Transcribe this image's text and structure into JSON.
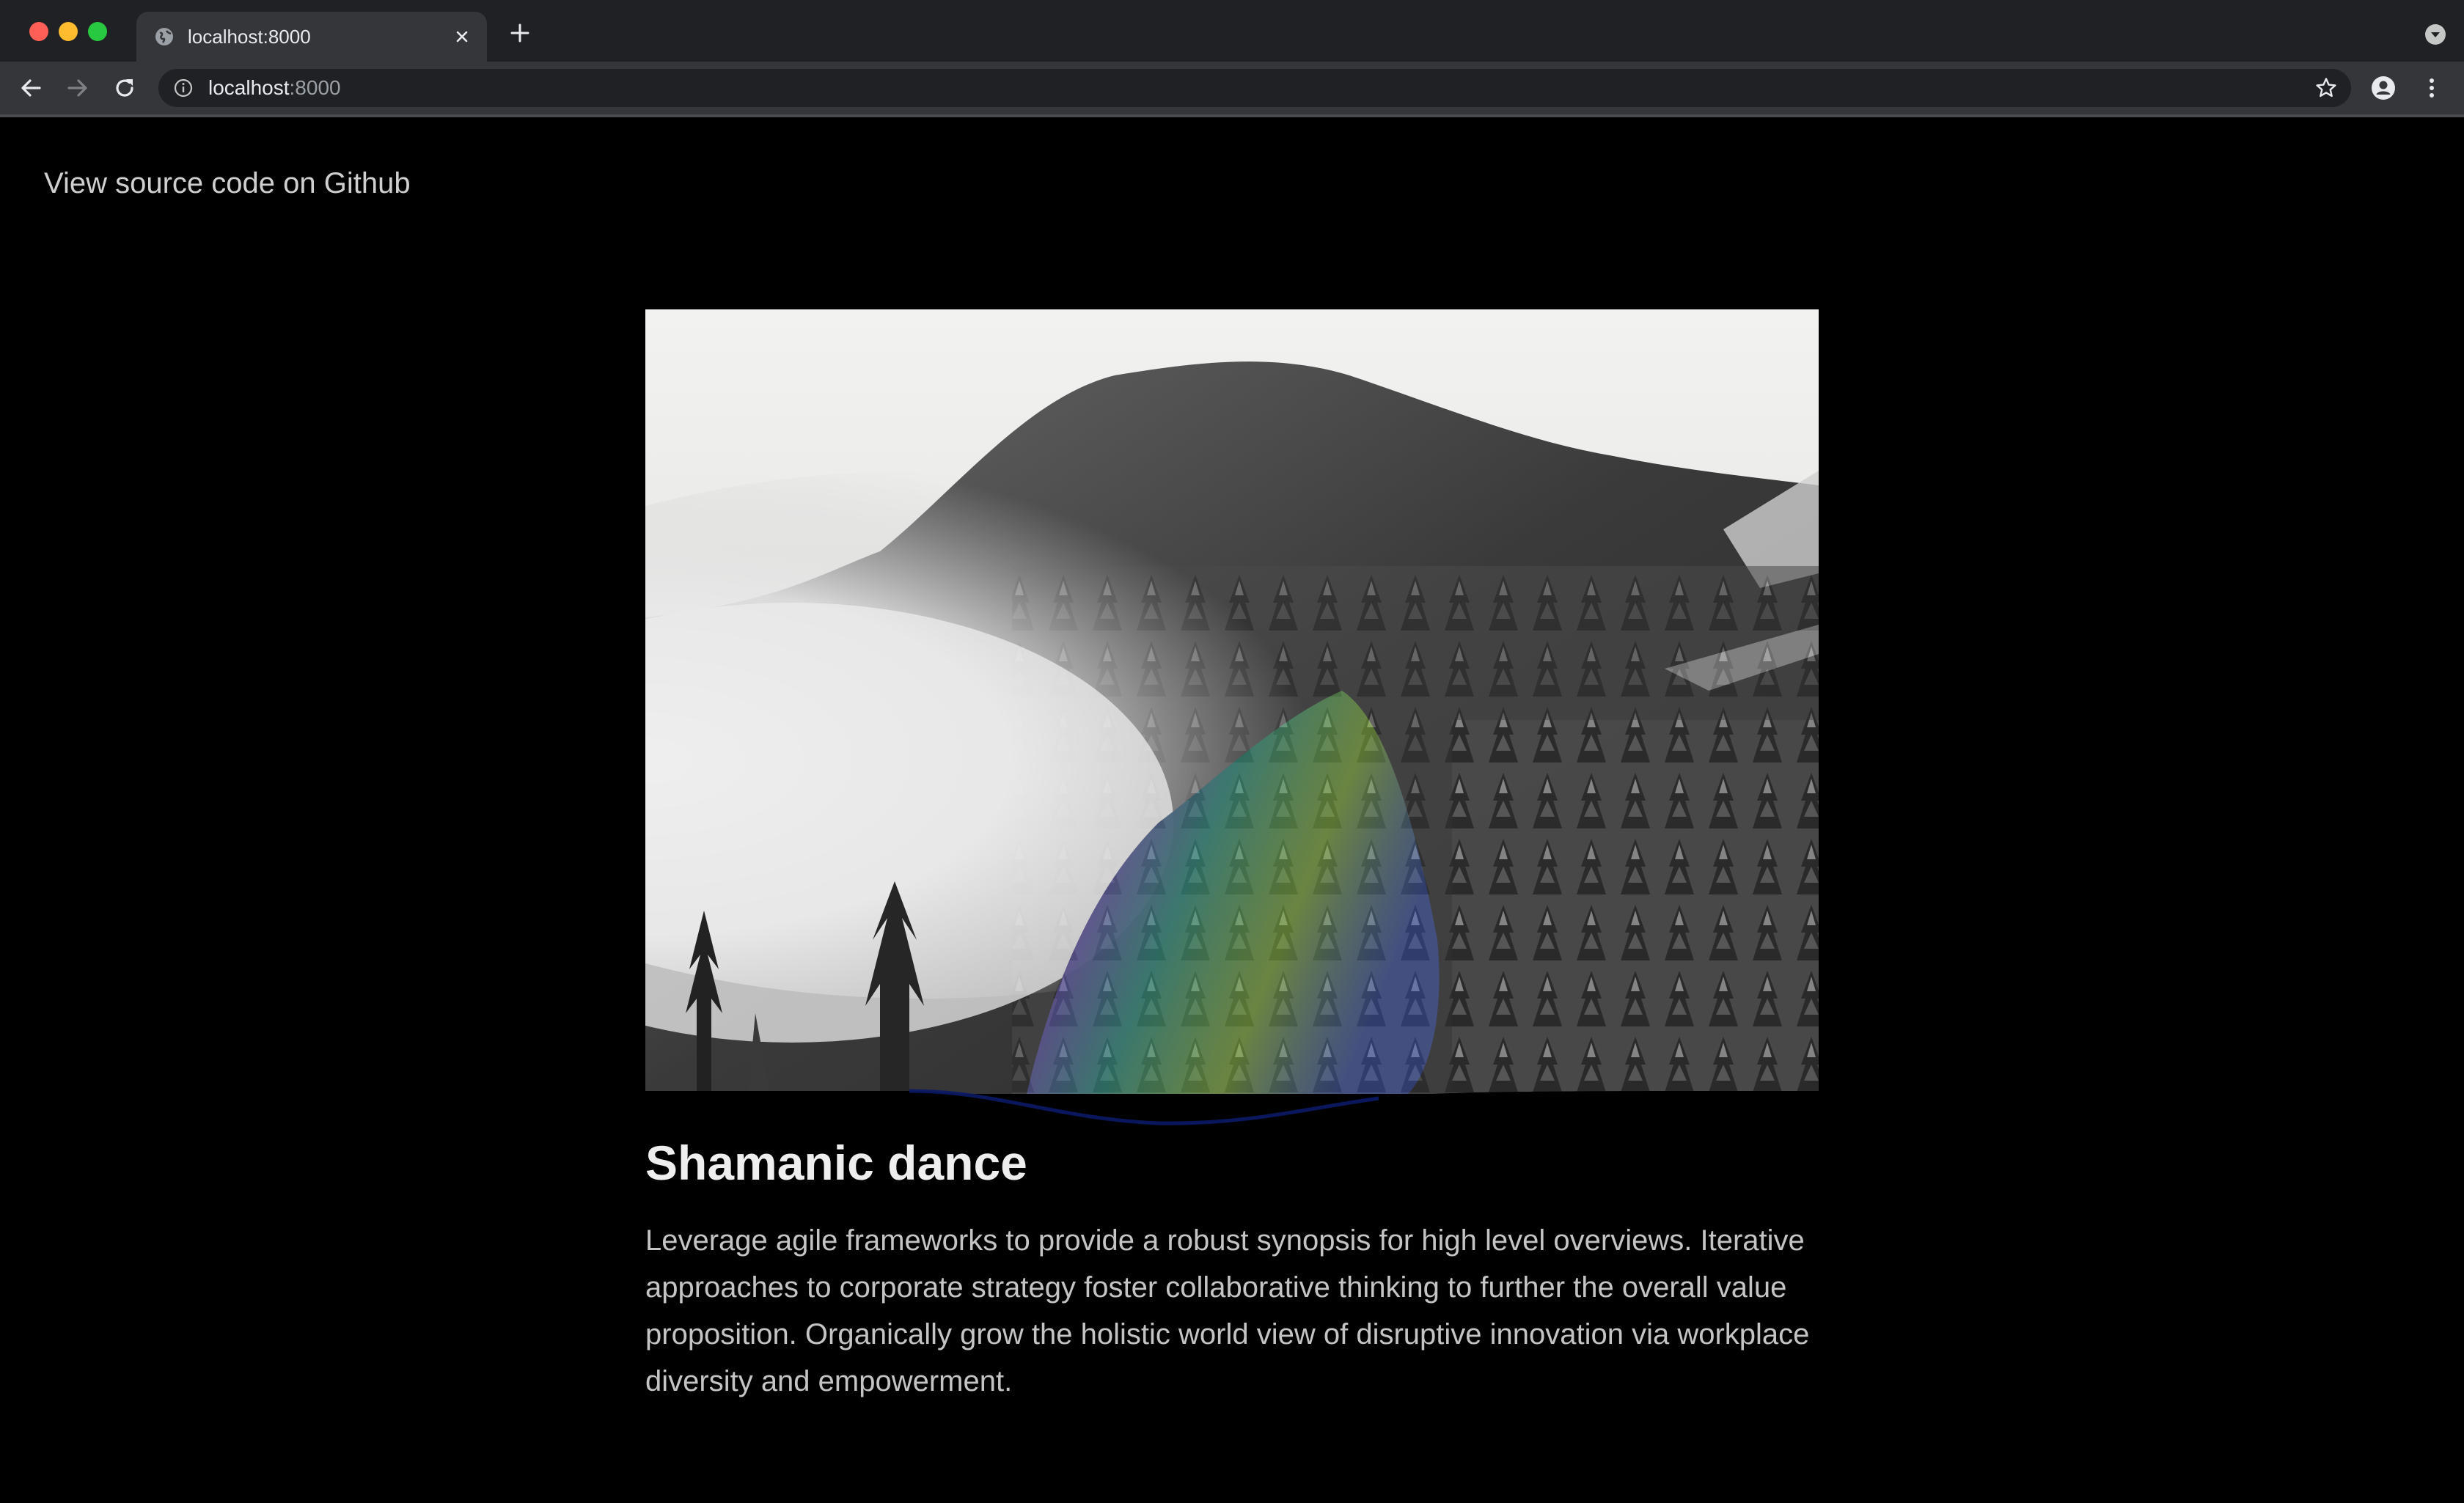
{
  "browser": {
    "tab_title": "localhost:8000",
    "url_host": "localhost",
    "url_port": ":8000"
  },
  "icons": {
    "tab_favicon": "globe-icon",
    "tab_close": "close-icon",
    "new_tab": "plus-icon",
    "tab_search": "chevron-down-icon",
    "back": "arrow-left-icon",
    "forward": "arrow-right-icon",
    "reload": "reload-icon",
    "site_info": "info-icon",
    "bookmark": "star-icon",
    "profile": "person-icon",
    "menu": "kebab-menu-icon"
  },
  "page": {
    "github_link": "View source code on Github",
    "article": {
      "title": "Shamanic dance",
      "body": "Leverage agile frameworks to provide a robust synopsis for high level overviews. Iterative approaches to corporate strategy foster collaborative thinking to further the overall value proposition. Organically grow the holistic world view of disruptive innovation via workplace diversity and empowerment."
    }
  },
  "colors": {
    "page_background": "#000000",
    "tabstrip": "#202124",
    "toolbar": "#35363a",
    "text_primary": "#eeeeee",
    "text_secondary": "#c4c4c4"
  }
}
